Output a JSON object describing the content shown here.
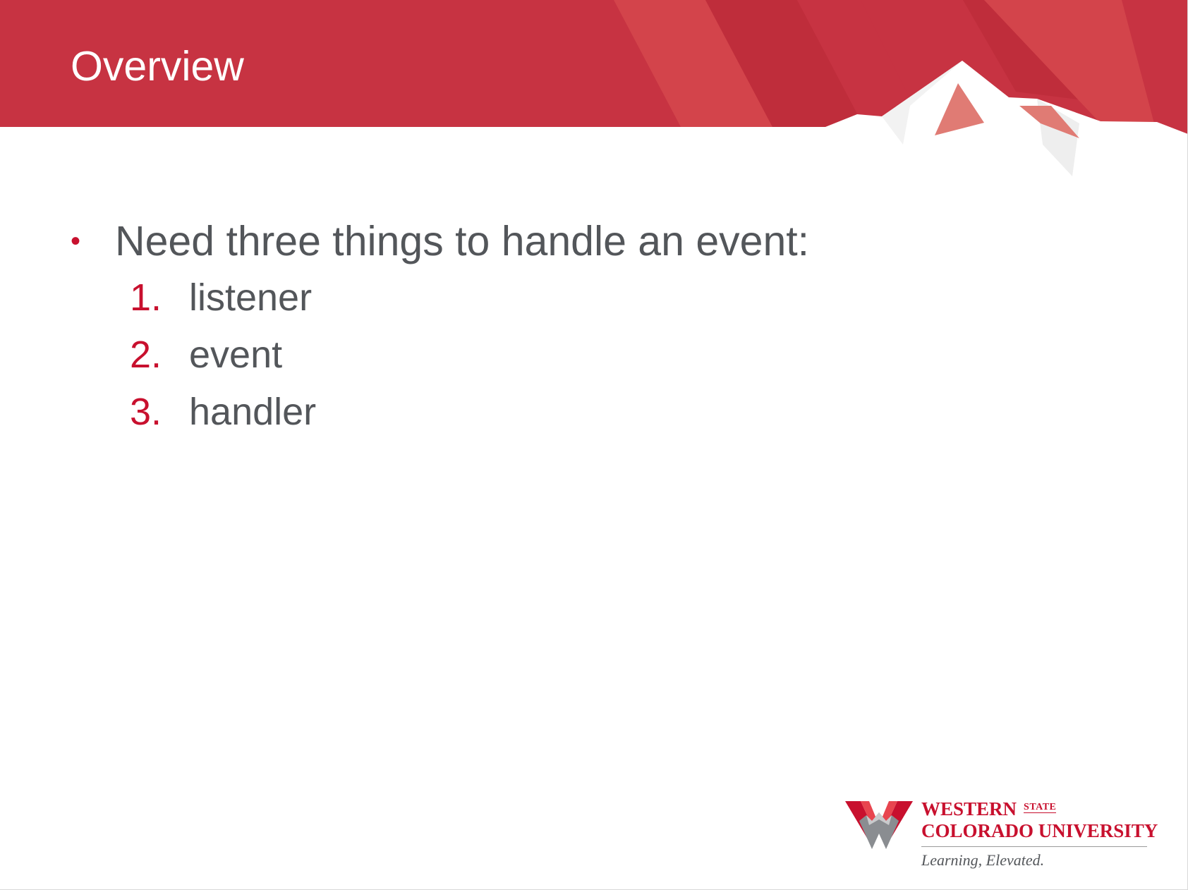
{
  "slide": {
    "title": "Overview",
    "bullet": {
      "text": "Need three things to handle an event:",
      "items": [
        {
          "number": "1.",
          "text": "listener"
        },
        {
          "number": "2.",
          "text": "event"
        },
        {
          "number": "3.",
          "text": "handler"
        }
      ]
    }
  },
  "logo": {
    "line1": "WESTERN",
    "state": "STATE",
    "line2": "COLORADO UNIVERSITY",
    "tagline": "Learning, Elevated."
  },
  "colors": {
    "brand_red": "#c8102e",
    "header_red": "#c73342",
    "body_text": "#53565a"
  },
  "icons": {
    "bullet": "bullet-dot-icon",
    "logo_mark": "w-mountain-logo-icon"
  }
}
